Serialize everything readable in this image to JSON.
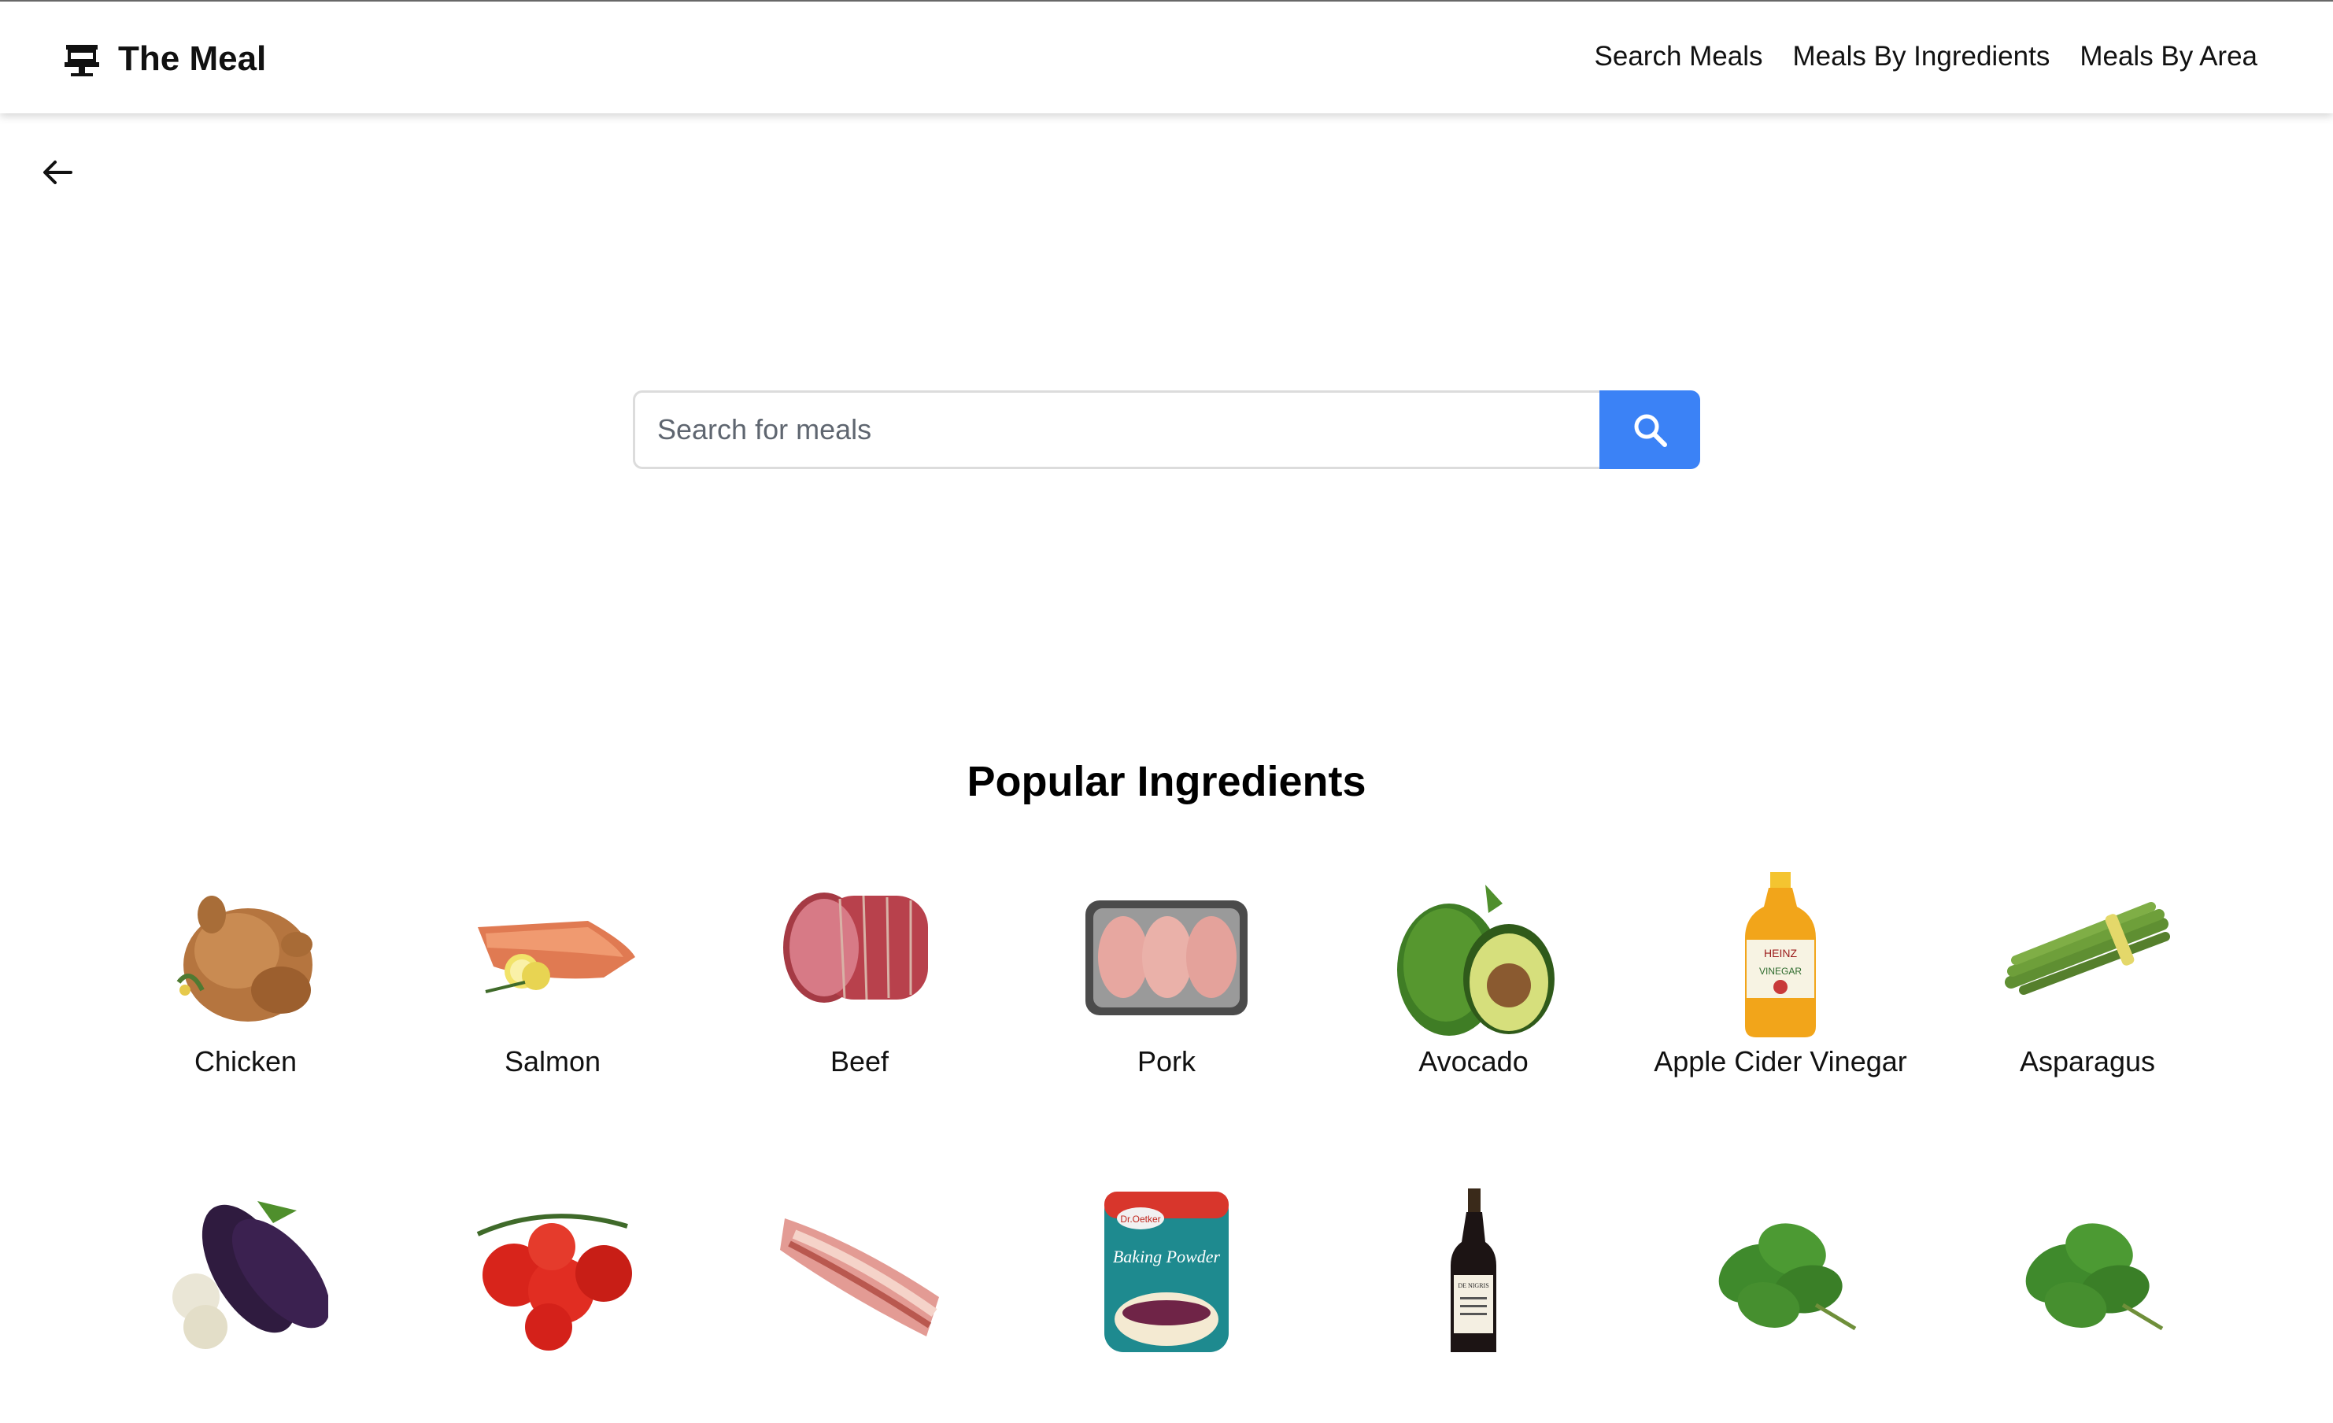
{
  "header": {
    "brand": "The Meal",
    "nav": [
      "Search Meals",
      "Meals By Ingredients",
      "Meals By Area"
    ]
  },
  "search": {
    "placeholder": "Search for meals",
    "value": ""
  },
  "section": {
    "title": "Popular Ingredients"
  },
  "ingredients": {
    "row1": [
      "Chicken",
      "Salmon",
      "Beef",
      "Pork",
      "Avocado",
      "Apple Cider Vinegar",
      "Asparagus"
    ],
    "row2": [
      "",
      "",
      "",
      "",
      "",
      "",
      ""
    ]
  },
  "image_text": {
    "vinegar_brand": "HEINZ",
    "vinegar_label": "VINEGAR",
    "baking_brand": "Dr.Oetker",
    "baking_label": "Baking Powder",
    "balsamic_brand": "DE NIGRIS"
  },
  "colors": {
    "accent": "#3b82f6",
    "divider": "#6b6b6b"
  },
  "icons": [
    "brand-icon",
    "arrow-left-icon",
    "search-icon"
  ]
}
